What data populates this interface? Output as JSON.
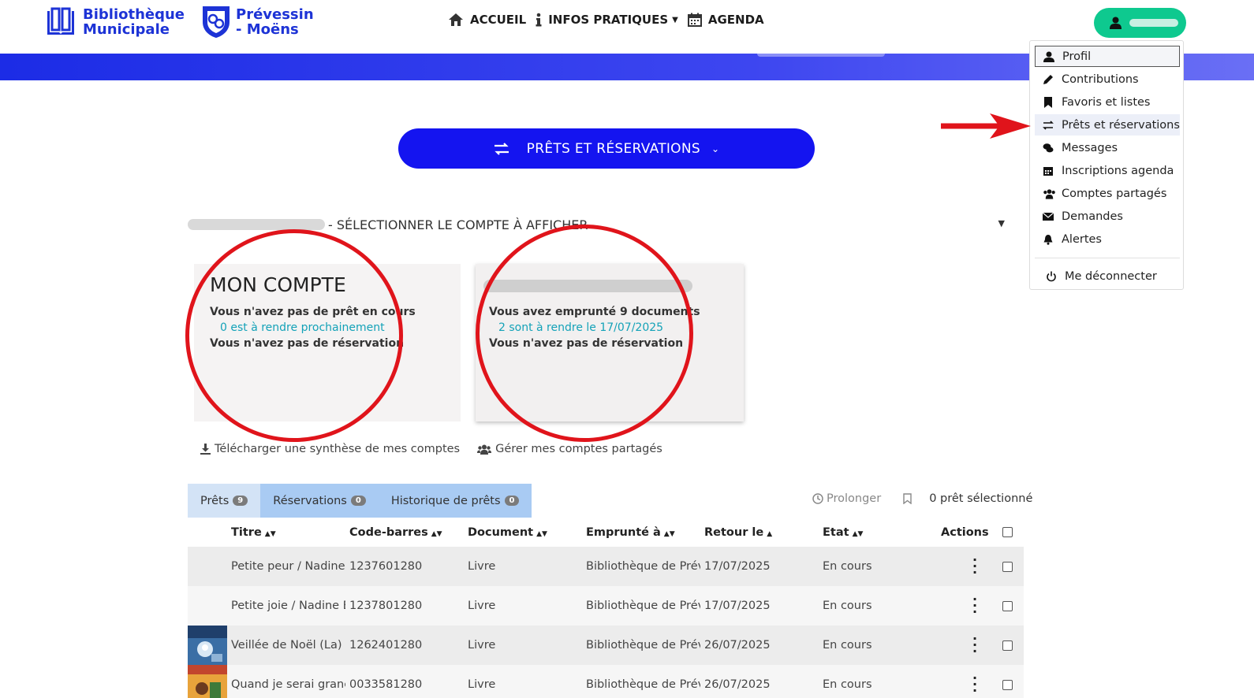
{
  "header": {
    "logo1": {
      "line1": "Bibliothèque",
      "line2": "Municipale"
    },
    "logo2": {
      "line1": "Prévessin",
      "line2": "- Moëns"
    },
    "nav": [
      {
        "label": "ACCUEIL",
        "icon": "home-icon"
      },
      {
        "label": "INFOS PRATIQUES",
        "icon": "info-icon",
        "has_caret": true
      },
      {
        "label": "AGENDA",
        "icon": "calendar-icon"
      }
    ],
    "user_button_icon": "user-icon"
  },
  "main_pill": {
    "label": "PRÊTS ET RÉSERVATIONS",
    "icon": "exchange-icon"
  },
  "account_select": {
    "label": "- SÉLECTIONNER LE COMPTE À AFFICHER"
  },
  "cards": [
    {
      "title": "MON COMPTE",
      "loans": "Vous n'avez pas de prêt en cours",
      "due": "0 est à rendre prochainement",
      "reservations": "Vous n'avez pas de réservation"
    },
    {
      "title": "",
      "loans": "Vous avez emprunté 9 documents",
      "due": "2 sont à rendre le 17/07/2025",
      "reservations": "Vous n'avez pas de réservation"
    }
  ],
  "links": {
    "download": "Télécharger une synthèse de mes comptes",
    "manage": "Gérer mes comptes partagés"
  },
  "tabs": [
    {
      "label": "Prêts",
      "count": "9"
    },
    {
      "label": "Réservations",
      "count": "0"
    },
    {
      "label": "Historique de prêts",
      "count": "0"
    }
  ],
  "tools": {
    "prolonger": "Prolonger",
    "selected": "0 prêt sélectionné"
  },
  "table": {
    "headers": {
      "titre": "Titre",
      "code": "Code-barres",
      "document": "Document",
      "emprunte": "Emprunté à",
      "retour": "Retour le",
      "etat": "Etat",
      "actions": "Actions"
    },
    "rows": [
      {
        "titre": "Petite peur / Nadine",
        "code": "1237601280",
        "document": "Livre",
        "emprunte": "Bibliothèque de Prév",
        "retour": "17/07/2025",
        "etat": "En cours"
      },
      {
        "titre": "Petite joie / Nadine B",
        "code": "1237801280",
        "document": "Livre",
        "emprunte": "Bibliothèque de Prév",
        "retour": "17/07/2025",
        "etat": "En cours"
      },
      {
        "titre": "Veillée de Noël (La) /",
        "code": "1262401280",
        "document": "Livre",
        "emprunte": "Bibliothèque de Prév",
        "retour": "26/07/2025",
        "etat": "En cours"
      },
      {
        "titre": "Quand je serai granc",
        "code": "0033581280",
        "document": "Livre",
        "emprunte": "Bibliothèque de Prév",
        "retour": "26/07/2025",
        "etat": "En cours"
      }
    ]
  },
  "dropdown": [
    {
      "label": "Profil",
      "icon": "user-icon"
    },
    {
      "label": "Contributions",
      "icon": "pencil-icon"
    },
    {
      "label": "Favoris et listes",
      "icon": "bookmark-icon"
    },
    {
      "label": "Prêts et réservations",
      "icon": "exchange-icon"
    },
    {
      "label": "Messages",
      "icon": "comments-icon"
    },
    {
      "label": "Inscriptions agenda",
      "icon": "calendar-icon"
    },
    {
      "label": "Comptes partagés",
      "icon": "users-icon"
    },
    {
      "label": "Demandes",
      "icon": "envelope-icon"
    },
    {
      "label": "Alertes",
      "icon": "bell-icon"
    },
    {
      "label": "Me déconnecter",
      "icon": "power-icon"
    }
  ],
  "colors": {
    "brand_blue": "#1414f0",
    "accent_green": "#0ec98f",
    "link_teal": "#14a2b8",
    "annotation_red": "#e0141b"
  }
}
